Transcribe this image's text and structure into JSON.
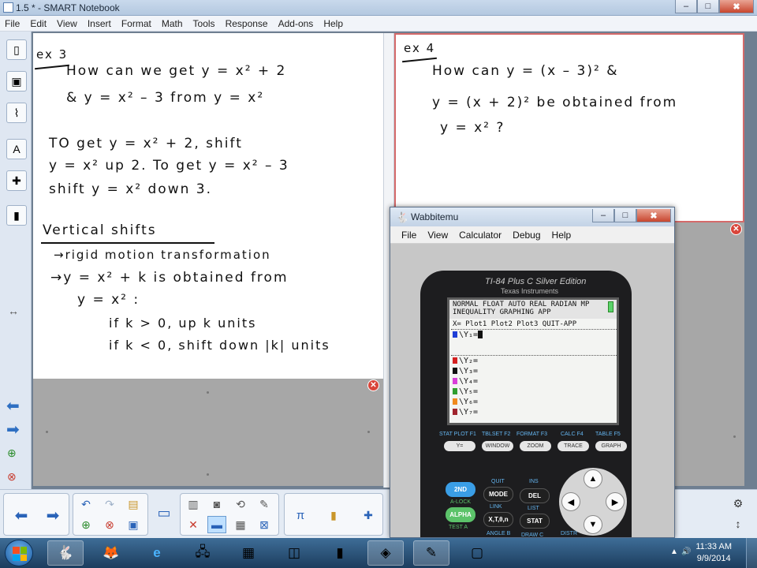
{
  "window": {
    "title": "1.5 * - SMART Notebook",
    "minimize": "‒",
    "maximize": "□",
    "close": "✖"
  },
  "menu": [
    "File",
    "Edit",
    "View",
    "Insert",
    "Format",
    "Math",
    "Tools",
    "Response",
    "Add-ons",
    "Help"
  ],
  "left_page": {
    "label": "ex 3",
    "lines": [
      "How can we get  y = x² + 2",
      "& y = x² – 3    from  y = x²",
      "TO get  y = x² + 2,  shift",
      "y = x²  up 2.  To get  y = x² – 3",
      "shift  y = x² down 3.",
      "Vertical shifts",
      "→rigid motion transformation",
      "→y = x² + k   is obtained from",
      "y = x² :",
      "if k > 0,  up k units",
      "if k < 0,  shift down |k| units"
    ]
  },
  "right_page": {
    "label": "ex 4",
    "lines": [
      "How can   y = (x – 3)²   &",
      "y = (x + 2)²  be obtained from",
      "y = x² ?"
    ]
  },
  "wabbitemu": {
    "title": "Wabbitemu",
    "menu": [
      "File",
      "View",
      "Calculator",
      "Debug",
      "Help"
    ],
    "model": "TI-84 Plus C Silver Edition",
    "maker": "Texas Instruments",
    "screen": {
      "status1": "NORMAL FLOAT AUTO REAL RADIAN MP",
      "status2": "INEQUALITY GRAPHING APP",
      "header": "X=  Plot1  Plot2  Plot3   QUIT-APP",
      "rows": [
        {
          "label": "\\Y₁=",
          "color": "#1f3fd6"
        },
        {
          "label": "\\Y₂=",
          "color": "#d42020"
        },
        {
          "label": "\\Y₃=",
          "color": "#111111"
        },
        {
          "label": "\\Y₄=",
          "color": "#d93fd9"
        },
        {
          "label": "\\Y₅=",
          "color": "#2f9e2f"
        },
        {
          "label": "\\Y₆=",
          "color": "#f08a1e"
        },
        {
          "label": "\\Y₇=",
          "color": "#a0242d"
        }
      ]
    },
    "fkey_labels": [
      "STAT PLOT F1",
      "TBLSET F2",
      "FORMAT F3",
      "CALC F4",
      "TABLE F5"
    ],
    "fkeys": [
      "Y=",
      "WINDOW",
      "ZOOM",
      "TRACE",
      "GRAPH"
    ],
    "keys": {
      "second": "2ND",
      "mode": "MODE",
      "del": "DEL",
      "alpha": "ALPHA",
      "xt": "X,T,θ,n",
      "stat": "STAT",
      "quit": "QUIT",
      "ins": "INS",
      "alock": "A-LOCK",
      "link": "LINK",
      "list": "LIST",
      "test": "TEST  A",
      "angle": "ANGLE  B",
      "draw": "DRAW  C",
      "distr": "DISTR"
    }
  },
  "taskbar": {
    "time": "11:33 AM",
    "date": "9/9/2014"
  }
}
